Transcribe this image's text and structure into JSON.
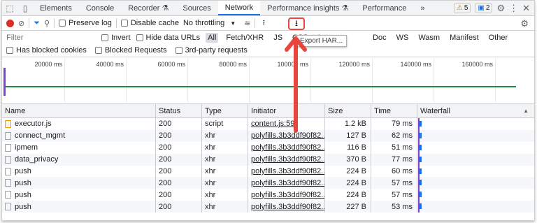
{
  "tabs": [
    "Elements",
    "Console",
    "Recorder",
    "Sources",
    "Network",
    "Performance insights",
    "Performance"
  ],
  "tab_more": "»",
  "badges": {
    "warnings": "5",
    "messages": "2"
  },
  "toolbar": {
    "preserve_log": "Preserve log",
    "disable_cache": "Disable cache",
    "throttling": "No throttling",
    "export_tooltip": "Export HAR..."
  },
  "filter": {
    "placeholder": "Filter",
    "invert": "Invert",
    "hide_data_urls": "Hide data URLs",
    "types": [
      "All",
      "Fetch/XHR",
      "JS",
      "CSS",
      "Img",
      "Doc",
      "WS",
      "Wasm",
      "Manifest",
      "Other"
    ]
  },
  "row3": {
    "has_blocked_cookies": "Has blocked cookies",
    "blocked_requests": "Blocked Requests",
    "third_party": "3rd-party requests"
  },
  "overview_ticks": [
    "20000 ms",
    "40000 ms",
    "60000 ms",
    "80000 ms",
    "100000 ms",
    "120000 ms",
    "140000 ms",
    "160000 ms"
  ],
  "columns": [
    "Name",
    "Status",
    "Type",
    "Initiator",
    "Size",
    "Time",
    "Waterfall"
  ],
  "requests": [
    {
      "name": "executor.js",
      "status": "200",
      "type": "script",
      "initiator": "content.js:59",
      "size": "1.2 kB",
      "time": "79 ms",
      "icon": "js-file-icon"
    },
    {
      "name": "connect_mgmt",
      "status": "200",
      "type": "xhr",
      "initiator": "polyfills.3b3ddf90f82...",
      "size": "127 B",
      "time": "62 ms",
      "icon": "document-icon"
    },
    {
      "name": "ipmem",
      "status": "200",
      "type": "xhr",
      "initiator": "polyfills.3b3ddf90f82...",
      "size": "116 B",
      "time": "51 ms",
      "icon": "document-icon"
    },
    {
      "name": "data_privacy",
      "status": "200",
      "type": "xhr",
      "initiator": "polyfills.3b3ddf90f82...",
      "size": "370 B",
      "time": "77 ms",
      "icon": "document-icon"
    },
    {
      "name": "push",
      "status": "200",
      "type": "xhr",
      "initiator": "polyfills.3b3ddf90f82...",
      "size": "224 B",
      "time": "60 ms",
      "icon": "document-icon"
    },
    {
      "name": "push",
      "status": "200",
      "type": "xhr",
      "initiator": "polyfills.3b3ddf90f82...",
      "size": "224 B",
      "time": "57 ms",
      "icon": "document-icon"
    },
    {
      "name": "push",
      "status": "200",
      "type": "xhr",
      "initiator": "polyfills.3b3ddf90f82...",
      "size": "224 B",
      "time": "57 ms",
      "icon": "document-icon"
    },
    {
      "name": "push",
      "status": "200",
      "type": "xhr",
      "initiator": "polyfills.3b3ddf90f82...",
      "size": "227 B",
      "time": "53 ms",
      "icon": "document-icon"
    }
  ],
  "colors": {
    "accent": "#1a73e8",
    "record": "#d93025",
    "highlight": "#e8453c",
    "timeline": "#1e8e3e"
  }
}
